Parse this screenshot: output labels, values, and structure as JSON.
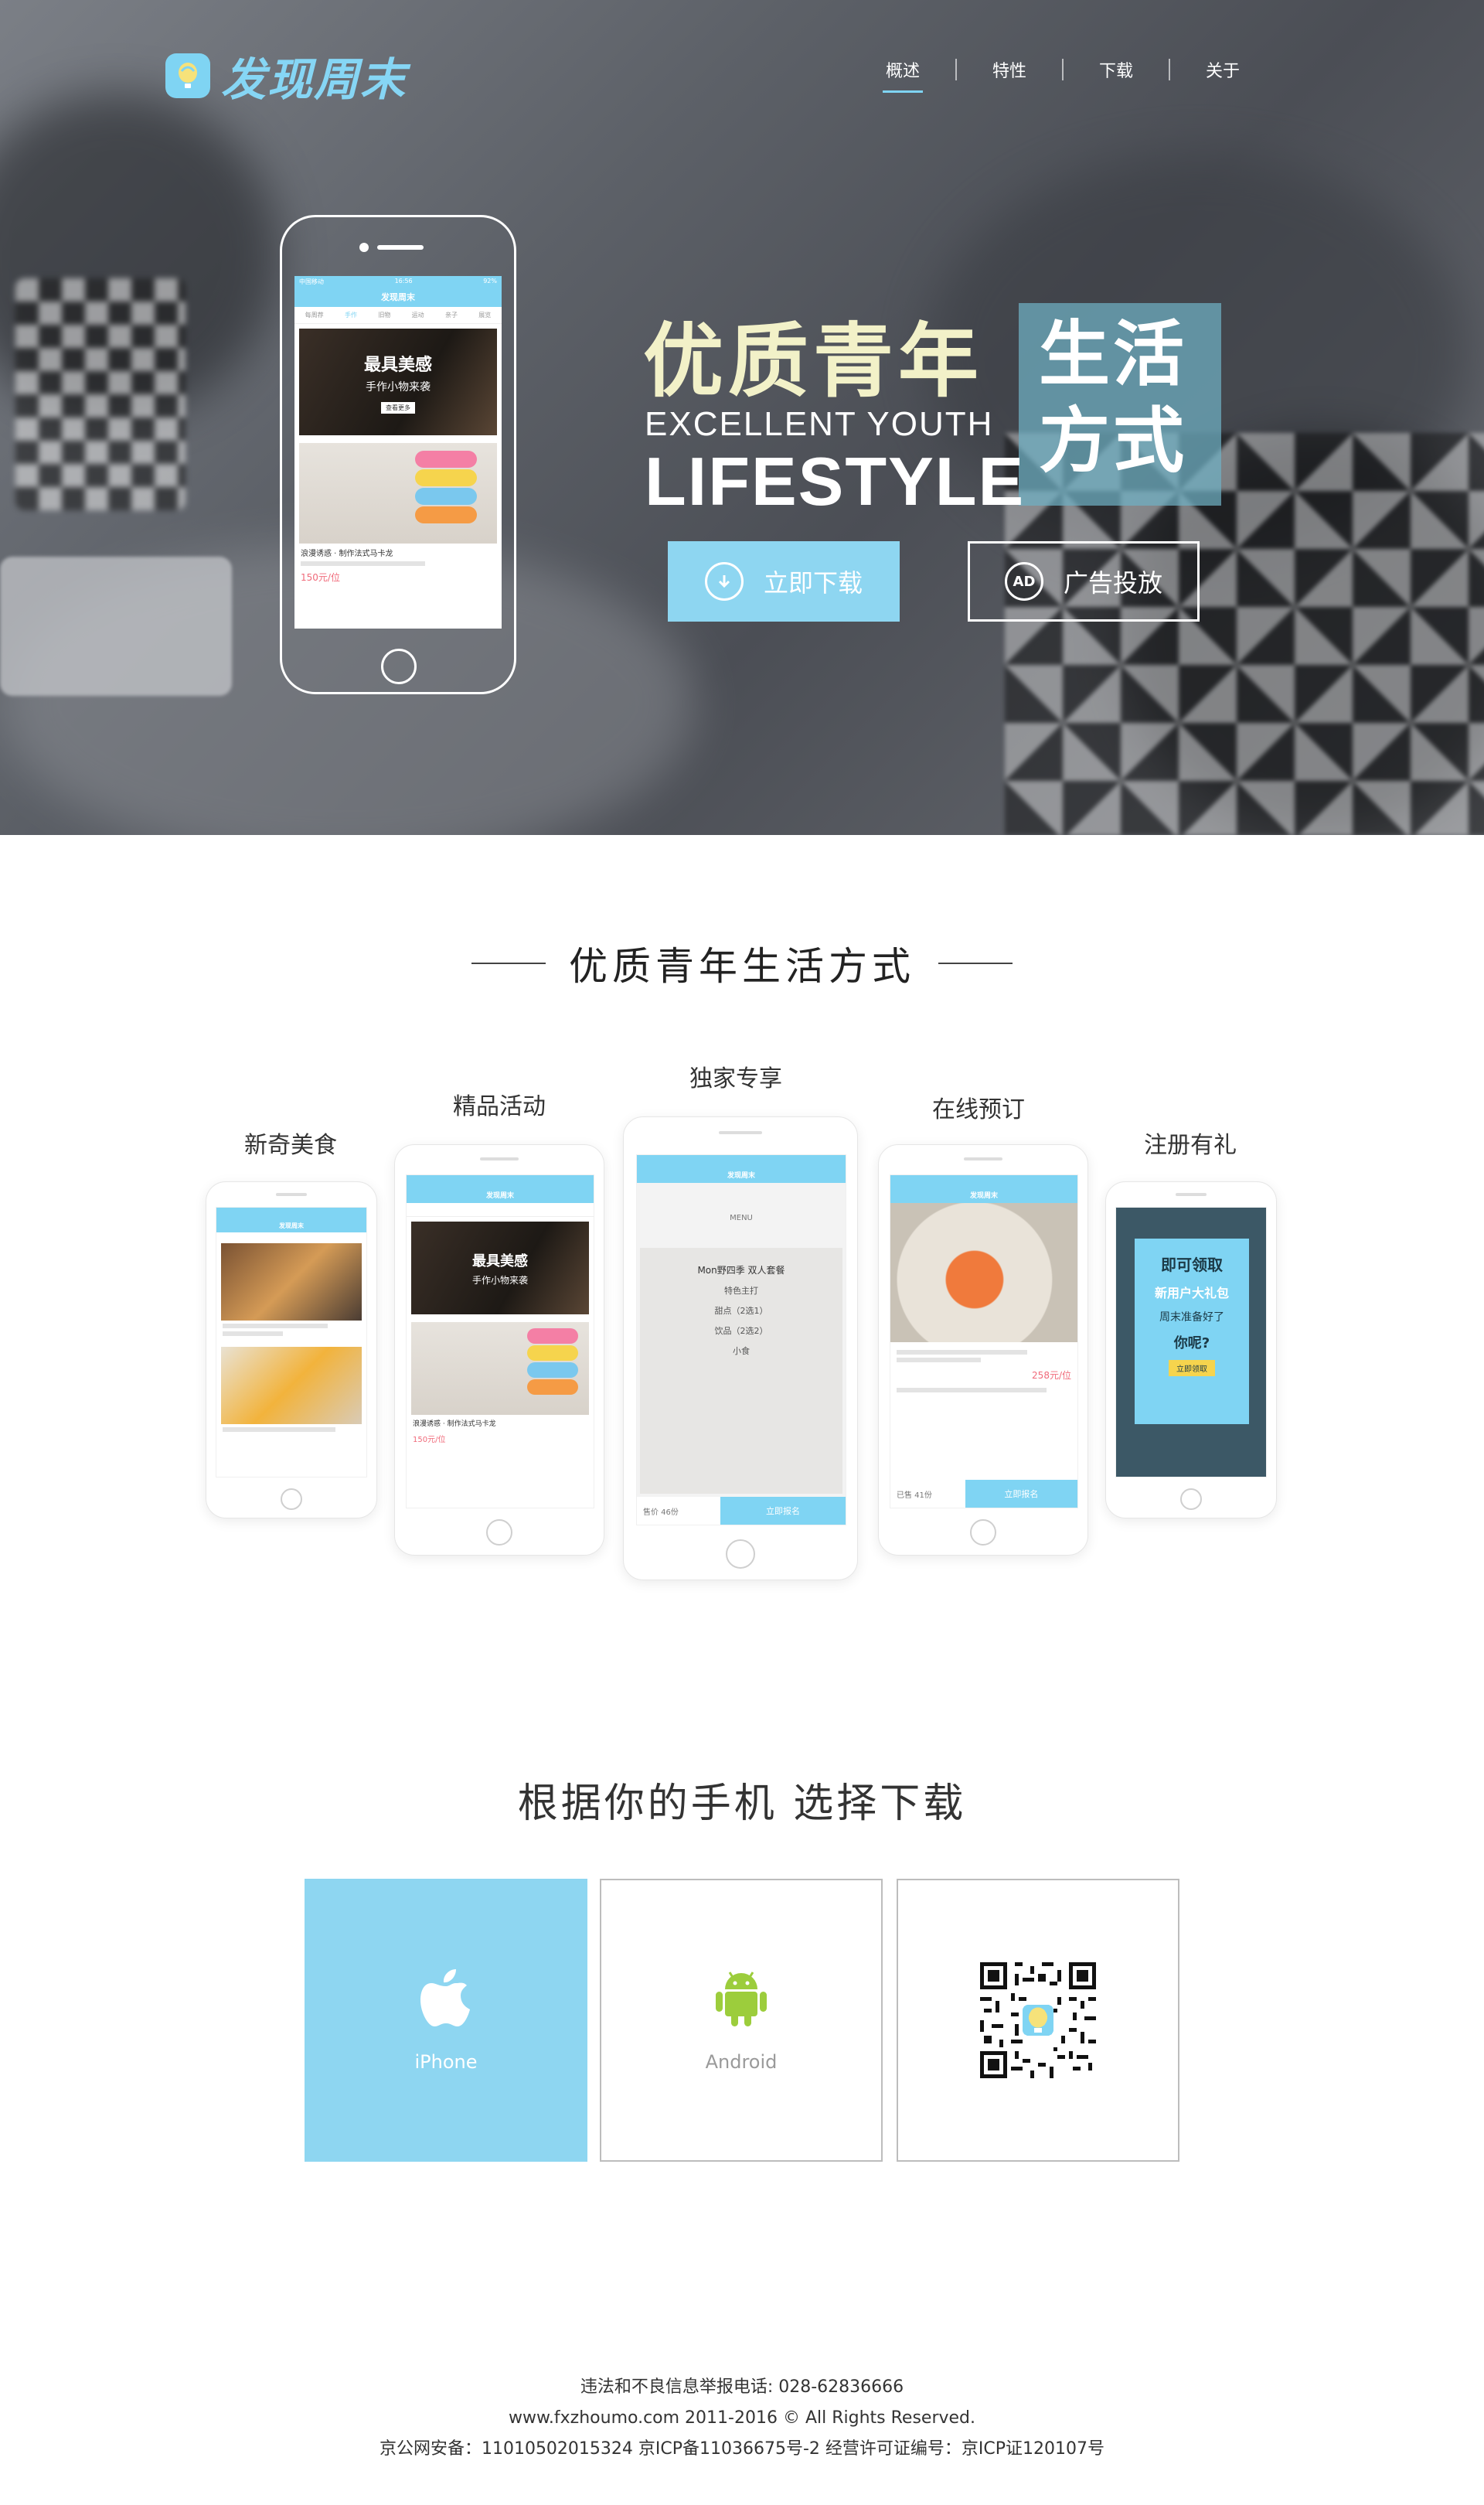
{
  "brand": {
    "name": "发现周末",
    "logo_icon": "balloon-icon",
    "accent": "#7fd4f3"
  },
  "nav": {
    "items": [
      "概述",
      "特性",
      "下载",
      "关于"
    ],
    "active": 0
  },
  "hero": {
    "title_cn": "优质青年",
    "box_cn_line1": "生活",
    "box_cn_line2": "方式",
    "title_en1": "EXCELLENT YOUTH",
    "title_en2": "LIFESTYLE",
    "download_label": "立即下载",
    "ad_label": "广告投放",
    "ad_icon_text": "AD",
    "phone": {
      "carrier": "中国移动",
      "time": "16:56",
      "battery": "92%",
      "app_title": "发现周末",
      "tabs": [
        "每周荐",
        "手作",
        "旧物",
        "运动",
        "亲子",
        "展览"
      ],
      "banner_big": "最具美感",
      "banner_small": "手作小物来袭",
      "banner_tag": "查看更多",
      "item_title": "浪漫诱惑 · 制作法式马卡龙",
      "price": "150元/位"
    }
  },
  "section_features": {
    "title": "优质青年生活方式",
    "features": [
      {
        "label": "新奇美食"
      },
      {
        "label": "精品活动"
      },
      {
        "label": "独家专享"
      },
      {
        "label": "在线预订"
      },
      {
        "label": "注册有礼"
      }
    ],
    "menu": {
      "header": "MENU",
      "name": "Mon野四季 双人套餐",
      "lines": [
        "特色主打",
        "甜点（2选1）",
        "饮品（2选2）",
        "小食"
      ],
      "price": "售价 46份",
      "cta": "立即报名"
    },
    "booking": {
      "price": "258元/位",
      "cta": "立即报名",
      "count": "已售 41份"
    },
    "promo": {
      "line1": "周末准备好了",
      "line2": "你呢?",
      "big": "即可领取",
      "gift": "新用户大礼包",
      "btn": "立即领取"
    }
  },
  "section_download": {
    "title": "根据你的手机  选择下载",
    "cards": [
      {
        "label": "iPhone",
        "icon": "apple-icon"
      },
      {
        "label": "Android",
        "icon": "android-icon"
      },
      {
        "label": "",
        "icon": "qr-code-icon"
      }
    ]
  },
  "footer": {
    "line1": "违法和不良信息举报电话: 028-62836666",
    "line2": "www.fxzhoumo.com 2011-2016 © All Rights Reserved.",
    "line3": "京公网安备：11010502015324 京ICP备11036675号-2 经营许可证编号：京ICP证120107号"
  }
}
